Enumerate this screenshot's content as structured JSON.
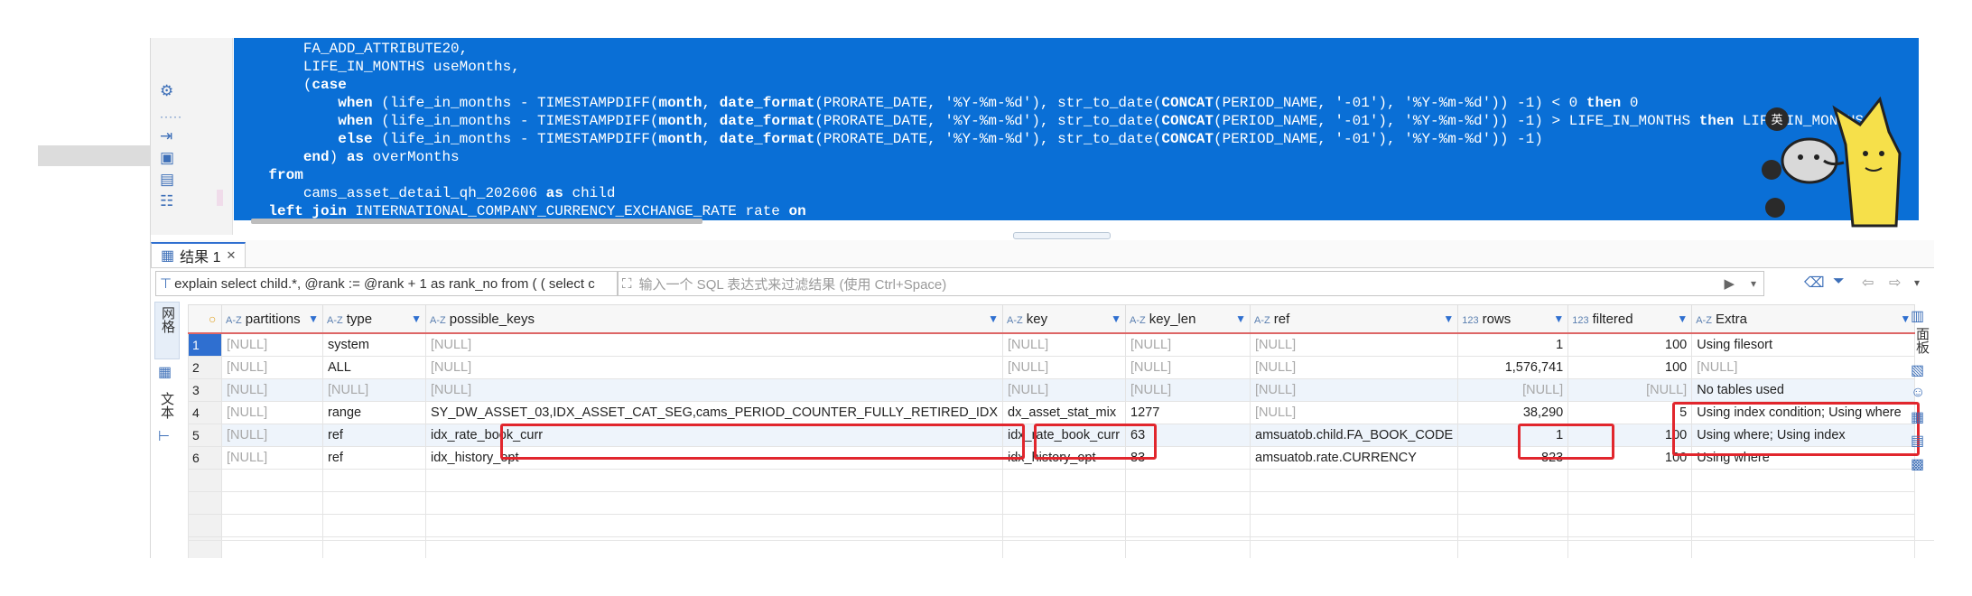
{
  "sql": {
    "lines": [
      "        FA_ADD_ATTRIBUTE20,",
      "        LIFE_IN_MONTHS useMonths,",
      "        (case",
      "            when (life_in_months - TIMESTAMPDIFF(month, date_format(PRORATE_DATE, '%Y-%m-%d'), str_to_date(CONCAT(PERIOD_NAME, '-01'), '%Y-%m-%d')) -1) < 0 then 0",
      "            when (life_in_months - TIMESTAMPDIFF(month, date_format(PRORATE_DATE, '%Y-%m-%d'), str_to_date(CONCAT(PERIOD_NAME, '-01'), '%Y-%m-%d')) -1) > LIFE_IN_MONTHS then LIFE_IN_MONTHS",
      "            else (life_in_months - TIMESTAMPDIFF(month, date_format(PRORATE_DATE, '%Y-%m-%d'), str_to_date(CONCAT(PERIOD_NAME, '-01'), '%Y-%m-%d')) -1)",
      "        end) as overMonths",
      "    from",
      "        cams_asset_detail_qh_202606 as child",
      "    left join INTERNATIONAL_COMPANY_CURRENCY_EXCHANGE_RATE rate on"
    ]
  },
  "mascot": {
    "badge_text": "英"
  },
  "tabs": {
    "result_label": "结果 1",
    "close_glyph": "✕"
  },
  "filter": {
    "query_text": "explain select child.*, @rank := @rank + 1 as rank_no from ( ( select c",
    "placeholder": "输入一个 SQL 表达式来过滤结果 (使用 Ctrl+Space)"
  },
  "side_tabs": {
    "grid_label": "网格",
    "text_label": "文本"
  },
  "right_panel": {
    "label": "面板"
  },
  "table": {
    "type_prefix_text": "A-Z",
    "type_prefix_num": "123",
    "columns": [
      {
        "name": "partitions",
        "kind": "text"
      },
      {
        "name": "type",
        "kind": "text"
      },
      {
        "name": "possible_keys",
        "kind": "text"
      },
      {
        "name": "key",
        "kind": "text"
      },
      {
        "name": "key_len",
        "kind": "text"
      },
      {
        "name": "ref",
        "kind": "text"
      },
      {
        "name": "rows",
        "kind": "num"
      },
      {
        "name": "filtered",
        "kind": "num"
      },
      {
        "name": "Extra",
        "kind": "text"
      }
    ],
    "rows": [
      {
        "n": "1",
        "partitions": "[NULL]",
        "type": "system",
        "possible_keys": "[NULL]",
        "key": "[NULL]",
        "key_len": "[NULL]",
        "ref": "[NULL]",
        "rows": "1",
        "filtered": "100",
        "extra": "Using filesort"
      },
      {
        "n": "2",
        "partitions": "[NULL]",
        "type": "ALL",
        "possible_keys": "[NULL]",
        "key": "[NULL]",
        "key_len": "[NULL]",
        "ref": "[NULL]",
        "rows": "1,576,741",
        "filtered": "100",
        "extra": "[NULL]"
      },
      {
        "n": "3",
        "partitions": "[NULL]",
        "type": "[NULL]",
        "possible_keys": "[NULL]",
        "key": "[NULL]",
        "key_len": "[NULL]",
        "ref": "[NULL]",
        "rows": "[NULL]",
        "filtered": "[NULL]",
        "extra": "No tables used"
      },
      {
        "n": "4",
        "partitions": "[NULL]",
        "type": "range",
        "possible_keys": "SY_DW_ASSET_03,IDX_ASSET_CAT_SEG,cams_PERIOD_COUNTER_FULLY_RETIRED_IDX",
        "key": "dx_asset_stat_mix",
        "key_len": "1277",
        "ref": "[NULL]",
        "rows": "38,290",
        "filtered": "5",
        "extra": "Using index condition; Using where"
      },
      {
        "n": "5",
        "partitions": "[NULL]",
        "type": "ref",
        "possible_keys": "idx_rate_book_curr",
        "key": "idx_rate_book_curr",
        "key_len": "63",
        "ref": "amsuatob.child.FA_BOOK_CODE",
        "rows": "1",
        "filtered": "100",
        "extra": "Using where; Using index"
      },
      {
        "n": "6",
        "partitions": "[NULL]",
        "type": "ref",
        "possible_keys": "idx_history_opt",
        "key": "idx_history_opt",
        "key_len": "83",
        "ref": "amsuatob.rate.CURRENCY",
        "rows": "823",
        "filtered": "100",
        "extra": "Using where"
      }
    ]
  },
  "colors": {
    "editor_bg": "#0a6fd6",
    "highlight": "#e1262d",
    "selected_row_number": "#2f6fd0"
  }
}
